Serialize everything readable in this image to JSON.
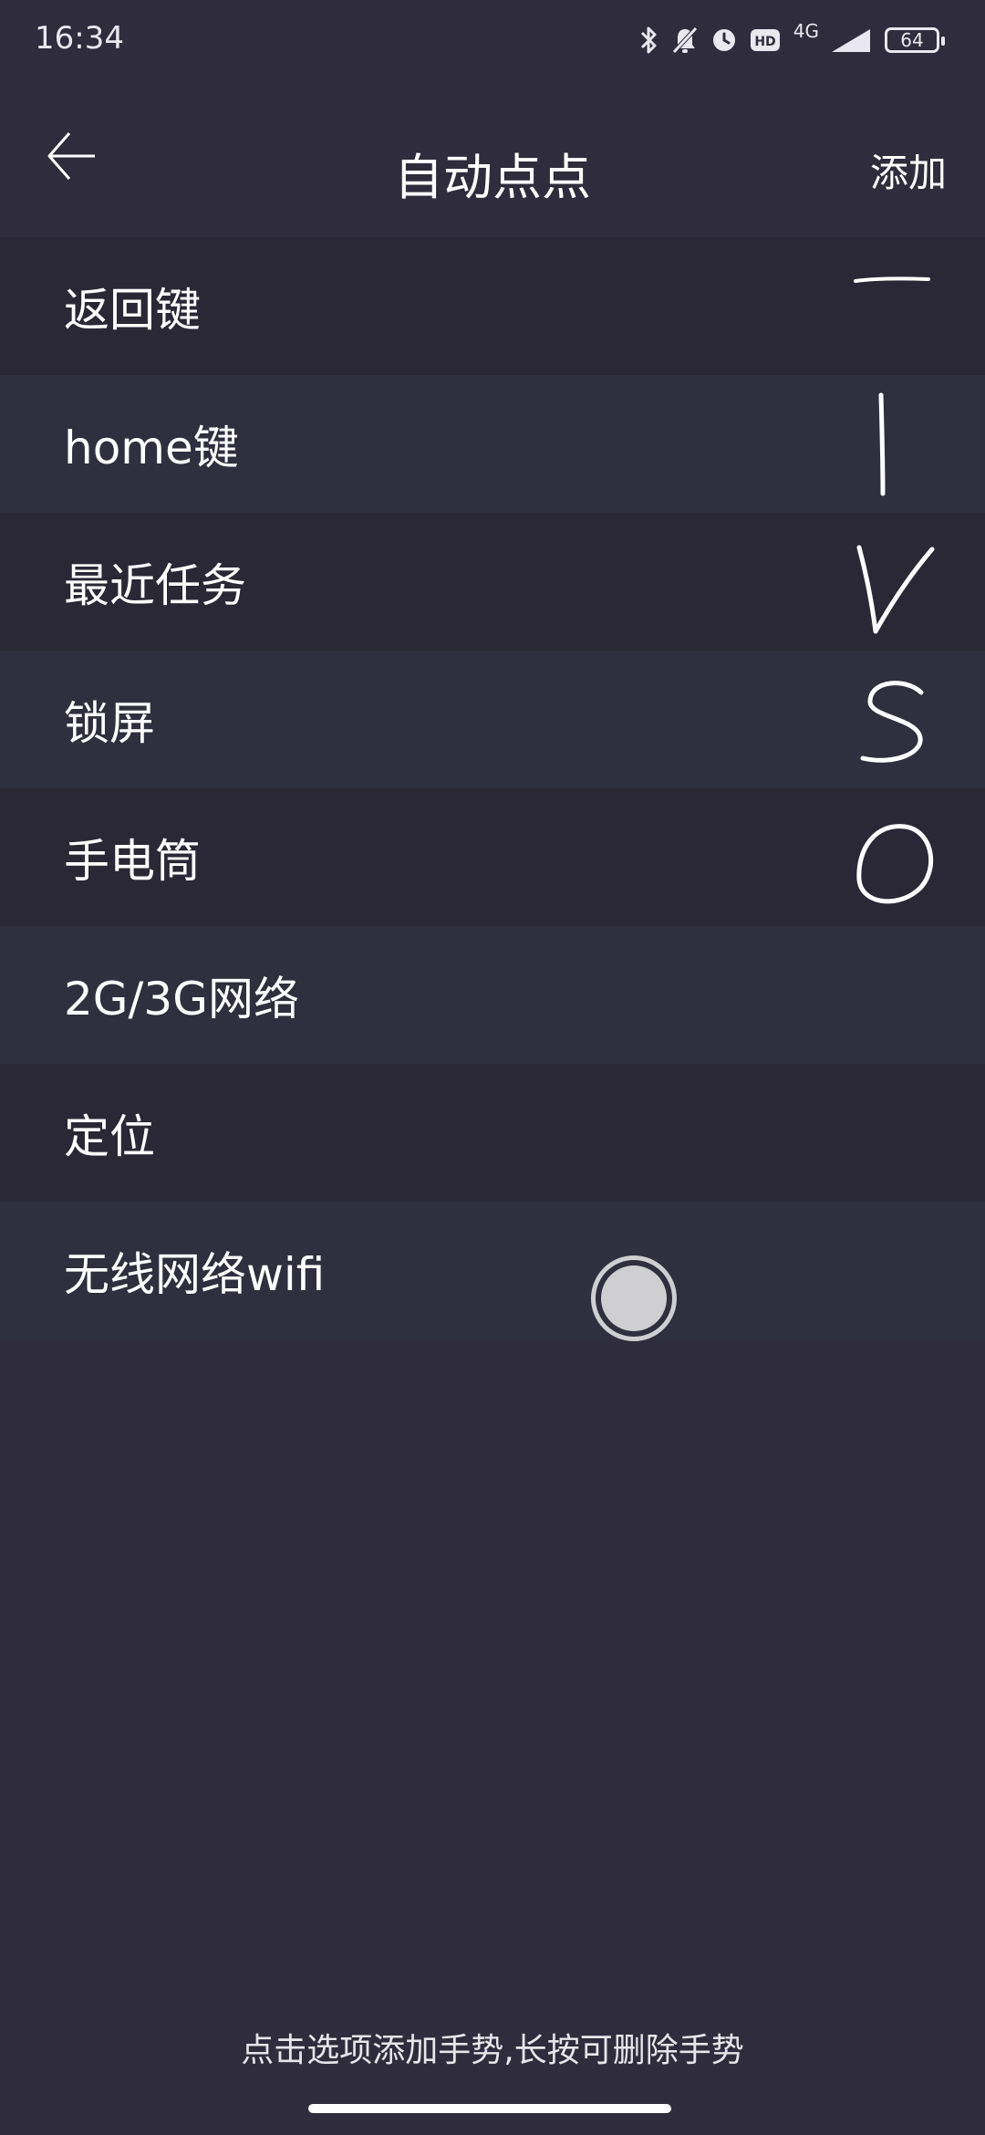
{
  "status_bar": {
    "time": "16:34",
    "network": "4G",
    "hd_badge": "HD",
    "battery": "64",
    "icons": [
      "bluetooth-icon",
      "mute-icon",
      "alarm-icon",
      "hd-icon",
      "signal-icon",
      "battery-icon"
    ]
  },
  "app_bar": {
    "title": "自动点点",
    "add_label": "添加",
    "back_icon": "arrow-left-icon"
  },
  "list": {
    "items": [
      {
        "label": "返回键",
        "gesture": "—"
      },
      {
        "label": "home键",
        "gesture": "|"
      },
      {
        "label": "最近任务",
        "gesture": "V"
      },
      {
        "label": "锁屏",
        "gesture": "S"
      },
      {
        "label": "手电筒",
        "gesture": "O"
      },
      {
        "label": "2G/3G网络",
        "gesture": ""
      },
      {
        "label": "定位",
        "gesture": ""
      },
      {
        "label": "无线网络wifi",
        "gesture": ""
      }
    ]
  },
  "hint": "点击选项添加手势,长按可删除手势",
  "colors": {
    "background": "#2f2d3b",
    "row_dark": "#2a2834",
    "row_light": "#302f3d",
    "text": "#ffffff"
  }
}
